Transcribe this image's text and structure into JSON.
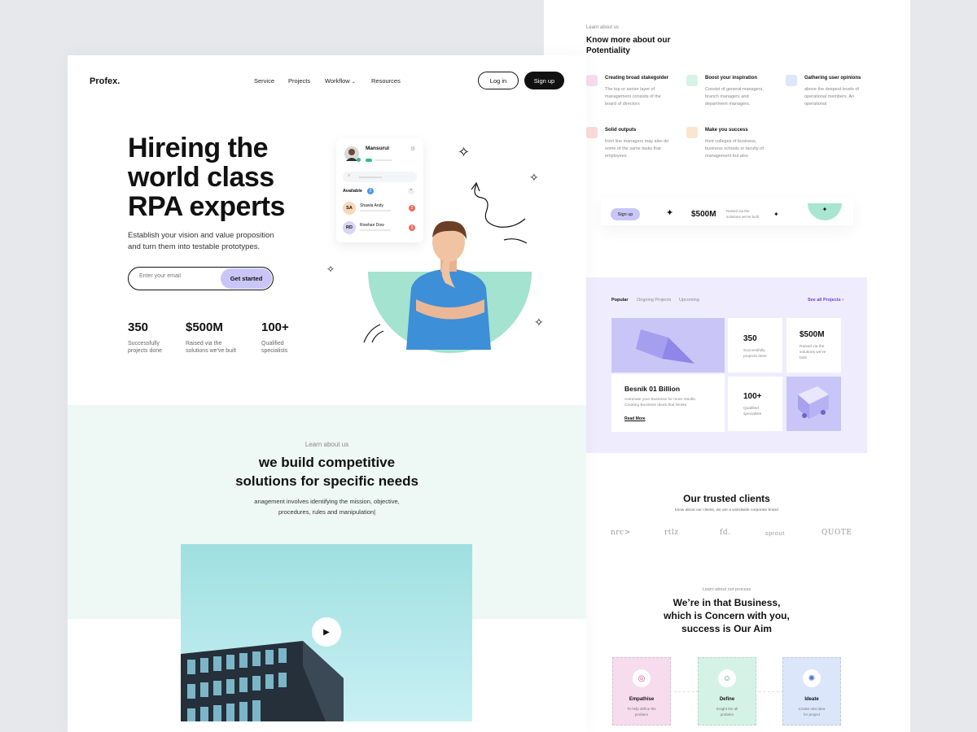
{
  "front": {
    "brand": "Profex.",
    "nav": [
      "Service",
      "Projects",
      "Workflow",
      "Resources"
    ],
    "login_label": "Log in",
    "signup_label": "Sign up",
    "hero": {
      "title_lines": [
        "Hireing the",
        "world class",
        "RPA experts"
      ],
      "subtitle_lines": [
        "Establish your vision and value proposition",
        "and turn them into testable prototypes."
      ],
      "email_placeholder": "Enter your email",
      "cta_label": "Get started"
    },
    "stats": [
      {
        "value": "350",
        "desc1": "Successfully",
        "desc2": "projects done"
      },
      {
        "value": "$500M",
        "desc1": "Raised via the",
        "desc2": "solutions we've built"
      },
      {
        "value": "100+",
        "desc1": "Qualified",
        "desc2": "specialists"
      }
    ],
    "profile_card": {
      "name": "Mansurul",
      "available_label": "Available",
      "available_count": "2",
      "people": [
        {
          "initials": "SA",
          "name": "Shawla Andy",
          "badge": "2"
        },
        {
          "initials": "RD",
          "name": "Rowhan Dow",
          "badge": "3"
        }
      ]
    },
    "about": {
      "eyebrow": "Learn about us",
      "title_lines": [
        "we build competitive",
        "solutions for specific needs"
      ],
      "desc_lines": [
        "anagement involves identifying the mission, objective,",
        "procedures, rules and manipulation|"
      ]
    }
  },
  "back": {
    "eyebrow": "Learn about us",
    "title_lines": [
      "Know more about our",
      "Potentiality"
    ],
    "features": [
      {
        "title": "Creating broad stakegolder",
        "desc": [
          "The top or senior layer of",
          "management consists of the",
          "board of directors"
        ],
        "color": "#f7dcef"
      },
      {
        "title": "Boost your inspiration",
        "desc": [
          "Consist of general managers,",
          "branch managers and",
          "department managers."
        ],
        "color": "#d6f3e8"
      },
      {
        "title": "Gathering user opinions",
        "desc": [
          "above the deepest levels of",
          "operational members. An",
          "operational"
        ],
        "color": "#dde6fb"
      },
      {
        "title": "Solid outputs",
        "desc": [
          "front line managers may also do",
          "some of the same tasks that",
          "employees"
        ],
        "color": "#fbdada"
      },
      {
        "title": "Make you success",
        "desc": [
          "their colleges of business,",
          "business schools or faculty of",
          "management but also"
        ],
        "color": "#fbe5cf"
      }
    ],
    "strip": {
      "signup_label": "Sign up",
      "value": "$500M",
      "desc": [
        "Raised via the",
        "solutions we've built"
      ]
    },
    "projects": {
      "tabs": [
        "Popular",
        "Ongoing Projects",
        "Upcoming"
      ],
      "see_all": "See all Projects",
      "stats": [
        {
          "value": "350",
          "desc": [
            "Successfully",
            "projects done"
          ]
        },
        {
          "value": "$500M",
          "desc": [
            "Raised via the",
            "solutions we've",
            "built"
          ]
        },
        {
          "value": "100+",
          "desc": [
            "Qualified",
            "specialists"
          ]
        }
      ],
      "feature": {
        "title": "Besnik 01 Billion",
        "desc": [
          "Automate your Business for more results.",
          "Creating Business Ideas that Works"
        ],
        "link": "Read More"
      }
    },
    "clients": {
      "title": "Our trusted clients",
      "subtitle": "know about our clients, we are a wolrdwide corporate brand",
      "logos": [
        "nrc>",
        "rtlz",
        "fd.",
        "sprout",
        "QUOTE"
      ]
    },
    "process": {
      "eyebrow": "Learn about our process",
      "title_lines": [
        "We’re in that Business,",
        "which is Concern with you,",
        "success is Our Aim"
      ],
      "steps": [
        {
          "title": "Empathise",
          "desc": [
            "To help define the",
            "problem"
          ],
          "color": "#f6dcec",
          "icon_color": "#d14d8a"
        },
        {
          "title": "Define",
          "desc": [
            "Insight the all",
            "probelm"
          ],
          "color": "#d4f3e6",
          "icon_color": "#2e9c78"
        },
        {
          "title": "Ideate",
          "desc": [
            "Create new idea",
            "for project"
          ],
          "color": "#dce6fb",
          "icon_color": "#4f6fd1"
        }
      ]
    }
  },
  "colors": {
    "accent_purple": "#c9c6f7",
    "mint": "#9fe1cb",
    "dark": "#111111"
  }
}
